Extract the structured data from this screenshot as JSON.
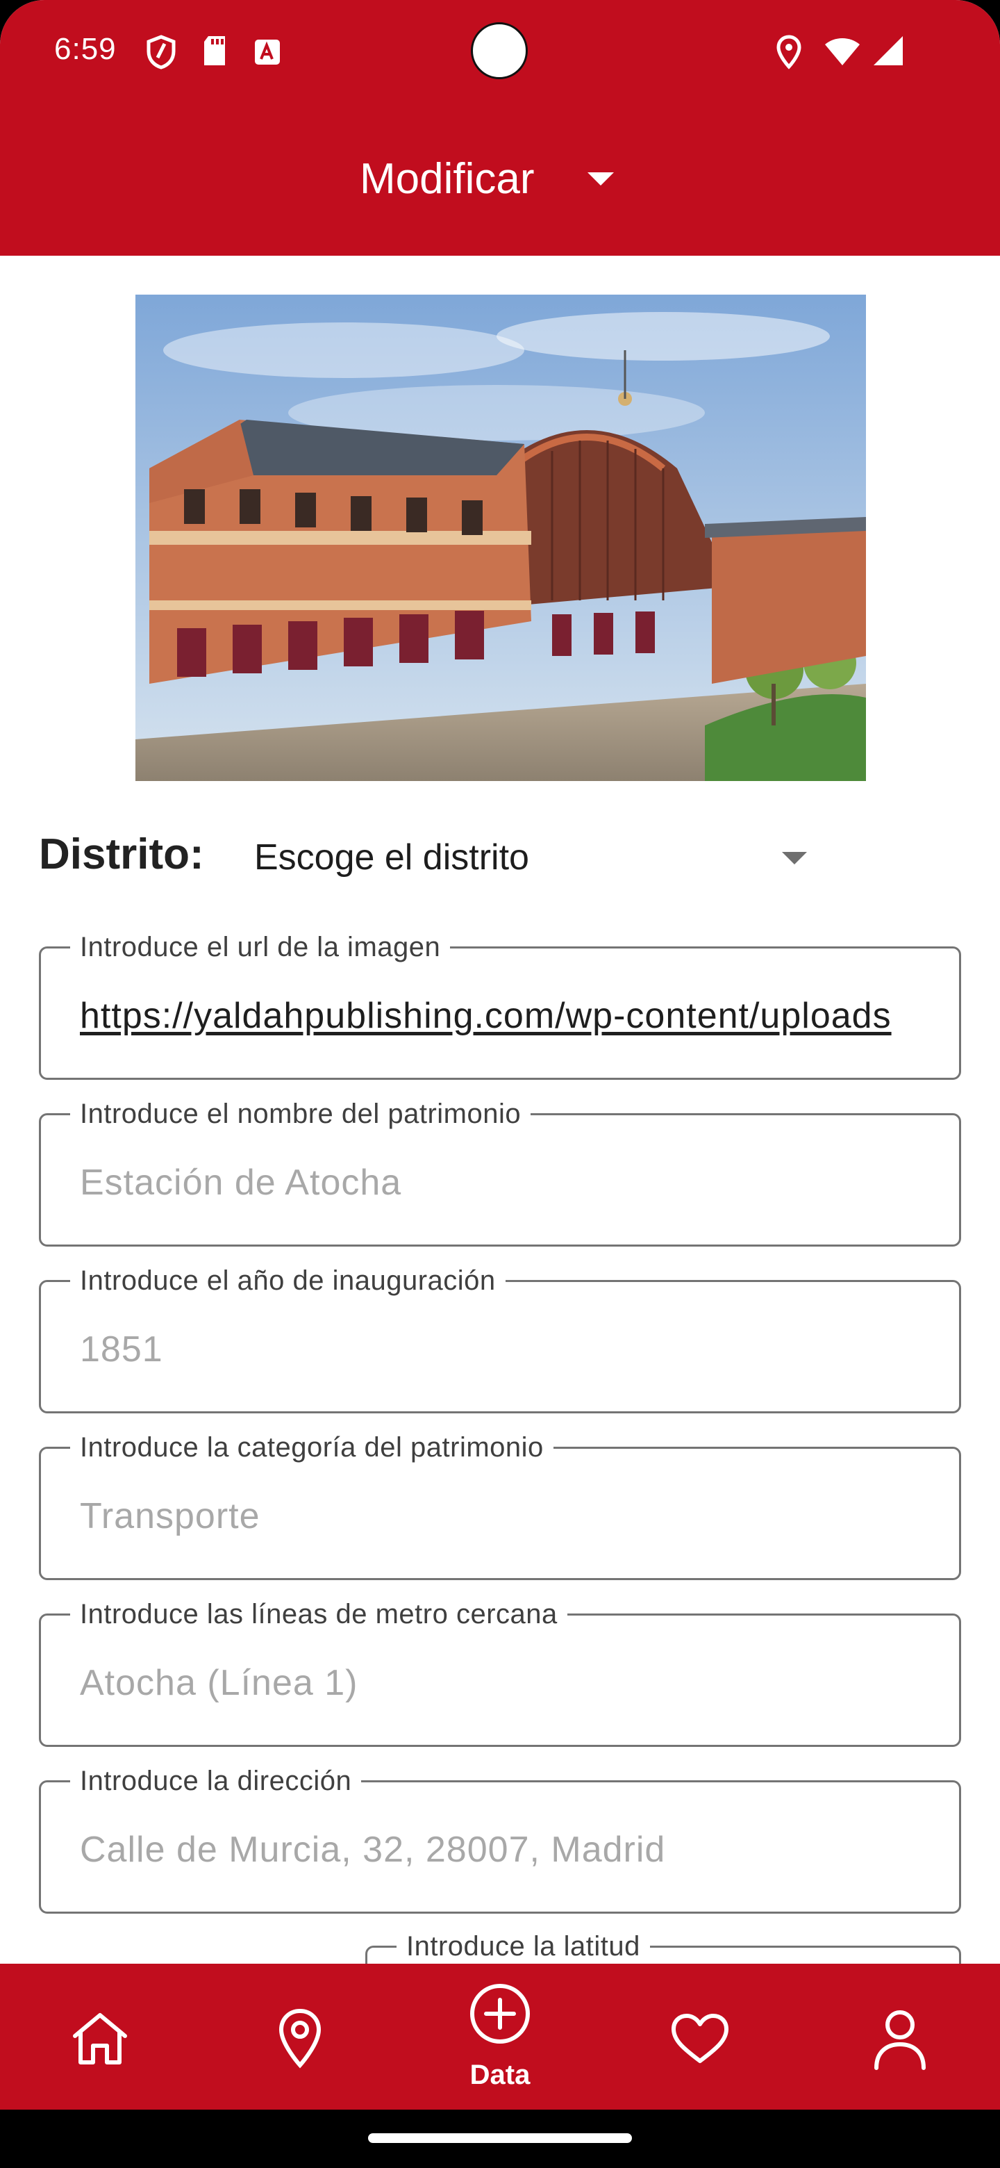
{
  "status_bar": {
    "time": "6:59"
  },
  "app_bar": {
    "title": "Modificar"
  },
  "district": {
    "label": "Distrito:",
    "selected": "Escoge el distrito"
  },
  "fields": {
    "image_url": {
      "label": "Introduce el url de la imagen",
      "value": "https://yaldahpublishing.com/wp-content/uploads"
    },
    "name": {
      "label": "Introduce el nombre del patrimonio",
      "placeholder": "Estación de Atocha"
    },
    "year": {
      "label": "Introduce el año de inauguración",
      "placeholder": "1851"
    },
    "category": {
      "label": "Introduce la categoría del patrimonio",
      "placeholder": "Transporte"
    },
    "metro": {
      "label": "Introduce las líneas de metro cercana",
      "placeholder": "Atocha (Línea 1)"
    },
    "address": {
      "label": "Introduce la dirección",
      "placeholder": "Calle de Murcia, 32, 28007, Madrid"
    },
    "latitude": {
      "label": "Introduce la latitud"
    }
  },
  "bottom_nav": {
    "data_label": "Data"
  },
  "colors": {
    "primary": "#c10d1e",
    "placeholder_text": "#a8a8a8",
    "outline": "#747474"
  }
}
